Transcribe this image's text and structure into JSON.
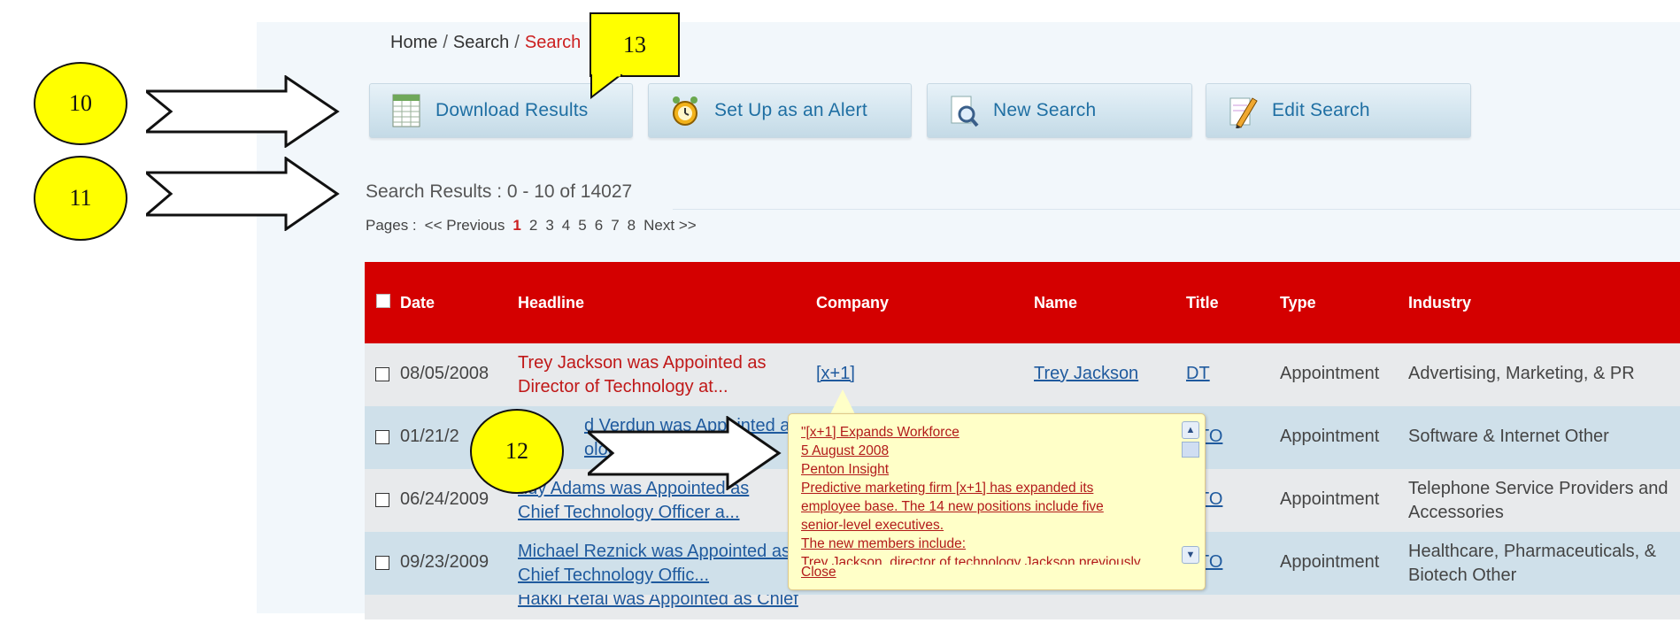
{
  "breadcrumb": {
    "home": "Home",
    "search": "Search",
    "current": "Search",
    "separator": "/"
  },
  "toolbar": {
    "download": {
      "label": "Download Results",
      "icon": "spreadsheet-icon"
    },
    "alert": {
      "label": "Set Up as an Alert",
      "icon": "alarm-clock-icon"
    },
    "new_search": {
      "label": "New Search",
      "icon": "magnifier-document-icon"
    },
    "edit_search": {
      "label": "Edit Search",
      "icon": "pencil-notepad-icon"
    }
  },
  "results": {
    "title": "Search Results : 0 - 10 of 14027",
    "pages_label": "Pages :",
    "prev": "<< Previous",
    "pages": [
      "1",
      "2",
      "3",
      "4",
      "5",
      "6",
      "7",
      "8"
    ],
    "active_page": "1",
    "next": "Next >>"
  },
  "table": {
    "headers": {
      "date": "Date",
      "headline": "Headline",
      "company": "Company",
      "name": "Name",
      "title": "Title",
      "type": "Type",
      "industry": "Industry"
    },
    "rows": [
      {
        "date": "08/05/2008",
        "headline_1": "Trey Jackson was Appointed as",
        "headline_2": "Director of Technology at...",
        "company": "[x+1]",
        "name": "Trey Jackson",
        "title": "DT",
        "type": "Appointment",
        "industry_1": "Advertising, Marketing, & PR",
        "industry_2": ""
      },
      {
        "date": "01/21/2",
        "headline_1": "d Verdun was Appointed as C",
        "headline_2": "ologi",
        "company": "",
        "name": "",
        "title": "TO",
        "type": "Appointment",
        "industry_1": "Software & Internet Other",
        "industry_2": ""
      },
      {
        "date": "06/24/2009",
        "headline_1": "ddy Adams was Appointed as",
        "headline_2": "Chief Technology Officer a...",
        "company": "",
        "name": "",
        "title": "TO",
        "type": "Appointment",
        "industry_1": "Telephone Service Providers and",
        "industry_2": "Accessories"
      },
      {
        "date": "09/23/2009",
        "headline_1": "Michael Reznick was Appointed as",
        "headline_2": "Chief Technology Offic...",
        "company": "",
        "name": "",
        "title": "TO",
        "type": "Appointment",
        "industry_1": "Healthcare, Pharmaceuticals, &",
        "industry_2": "Biotech Other"
      },
      {
        "date": "",
        "headline_1": "Hakki Refai was Appointed as Chief",
        "headline_2": "",
        "company": "",
        "name": "",
        "title": "",
        "type": "",
        "industry_1": "",
        "industry_2": ""
      }
    ]
  },
  "popup": {
    "lines": [
      "\"[x+1] Expands Workforce",
      "5 August 2008",
      "Penton Insight",
      "Predictive marketing firm [x+1] has expanded its",
      "employee base. The 14 new positions include five",
      "senior-level executives.",
      "The new members include:",
      "Trey Jackson, director of technology Jackson previously"
    ],
    "close": "Close"
  },
  "annotations": {
    "a10": "10",
    "a11": "11",
    "a12": "12",
    "a13": "13"
  },
  "colors": {
    "header_red": "#d40000",
    "link_blue": "#1f5a9e",
    "headline_red": "#c01818",
    "callout_yellow": "#ffff00",
    "popup_bg": "#ffffc8"
  }
}
